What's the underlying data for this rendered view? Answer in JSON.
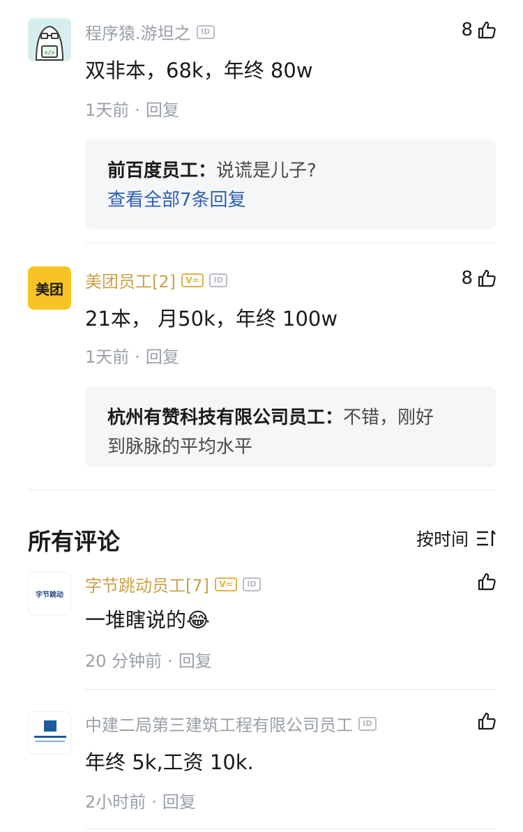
{
  "hot_comments": [
    {
      "author": "程序猿.游坦之",
      "id_badge": "ID",
      "likes": "8",
      "content": "双非本，68k，年终 80w",
      "time": "1天前",
      "reply_label": "回复",
      "replies": {
        "author": "前百度员工：",
        "text": "说谎是儿子?",
        "more": "查看全部7条回复"
      }
    },
    {
      "author": "美团员工[2]",
      "avatar_text": "美团",
      "v_badge": "V=",
      "id_badge": "ID",
      "likes": "8",
      "content": "21本， 月50k，年终 100w",
      "time": "1天前",
      "reply_label": "回复",
      "replies": {
        "author": "杭州有赞科技有限公司员工：",
        "text_line1": "不错，刚好",
        "text_line2": "到脉脉的平均水平"
      }
    }
  ],
  "all_comments_section": {
    "title": "所有评论",
    "sort_label": "按时间"
  },
  "all_comments": [
    {
      "author": "字节跳动员工[7]",
      "avatar_text": "字节跳动",
      "v_badge": "V=",
      "id_badge": "ID",
      "content": "一堆瞎说的😂",
      "time": "20 分钟前",
      "reply_label": "回复"
    },
    {
      "author": "中建二局第三建筑工程有限公司员工",
      "id_badge": "ID",
      "content": "年终 5k,工资 10k.",
      "time": "2小时前",
      "reply_label": "回复"
    }
  ],
  "colors": {
    "link": "#2d5fb4",
    "muted": "#9aa0a8",
    "gold": "#c9a24a",
    "meituan_yellow": "#f7c325"
  }
}
